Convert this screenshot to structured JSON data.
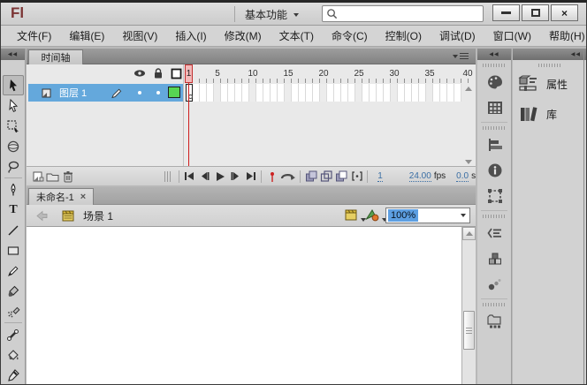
{
  "app": {
    "logo": "Fl",
    "workspace_switcher": "基本功能",
    "search_placeholder": "",
    "window_controls": {
      "close_glyph": "×"
    }
  },
  "menubar": {
    "items": [
      {
        "name": "file",
        "label": "文件(F)"
      },
      {
        "name": "edit",
        "label": "编辑(E)"
      },
      {
        "name": "view",
        "label": "视图(V)"
      },
      {
        "name": "insert",
        "label": "插入(I)"
      },
      {
        "name": "modify",
        "label": "修改(M)"
      },
      {
        "name": "text",
        "label": "文本(T)"
      },
      {
        "name": "commands",
        "label": "命令(C)"
      },
      {
        "name": "control",
        "label": "控制(O)"
      },
      {
        "name": "debug",
        "label": "调试(D)"
      },
      {
        "name": "window",
        "label": "窗口(W)"
      },
      {
        "name": "help",
        "label": "帮助(H)"
      }
    ]
  },
  "timeline": {
    "tab_label": "时间轴",
    "layer_name": "图层 1",
    "ruler": [
      {
        "frame": 1,
        "label": "1"
      },
      {
        "frame": 5,
        "label": "5"
      },
      {
        "frame": 10,
        "label": "10"
      },
      {
        "frame": 15,
        "label": "15"
      },
      {
        "frame": 20,
        "label": "20"
      },
      {
        "frame": 25,
        "label": "25"
      },
      {
        "frame": 30,
        "label": "30"
      },
      {
        "frame": 35,
        "label": "35"
      },
      {
        "frame": 40,
        "label": "40"
      }
    ],
    "status": {
      "current_frame": "1",
      "fps_value": "24.00",
      "fps_unit": "fps",
      "elapsed_value": "0.0",
      "elapsed_unit": "s"
    }
  },
  "document": {
    "tab_label": "未命名-1",
    "tab_close_glyph": "×",
    "scene_label": "场景 1",
    "zoom_value": "100%"
  },
  "toolbar": {
    "selected_tool": "selection",
    "text_tool_glyph": "T",
    "tools": [
      "selection",
      "subselection",
      "free-transform",
      "3d-rotation",
      "lasso",
      "pen",
      "text",
      "line",
      "rectangle",
      "pencil",
      "brush",
      "spray-brush",
      "bone",
      "paint-bucket",
      "eyedropper"
    ]
  },
  "right_dock": {
    "panel_buttons": [
      {
        "name": "properties",
        "label": "属性"
      },
      {
        "name": "library",
        "label": "库"
      }
    ],
    "icon_strip": [
      "color-panel",
      "swatches-panel",
      "align-panel",
      "info-panel",
      "transform-panel",
      "actions-panel",
      "components-panel",
      "motion-presets-panel",
      "project-panel"
    ]
  },
  "colors": {
    "selection_blue": "#64a8dc",
    "playhead_red": "#cf1d1d",
    "layer_outline_green": "#57d553",
    "hot_text_blue": "#3b6fa5",
    "logo_maroon": "#7b3434",
    "scene_icon_yellow": "#e0c34a",
    "zoom_highlight": "#5d9fe2"
  }
}
